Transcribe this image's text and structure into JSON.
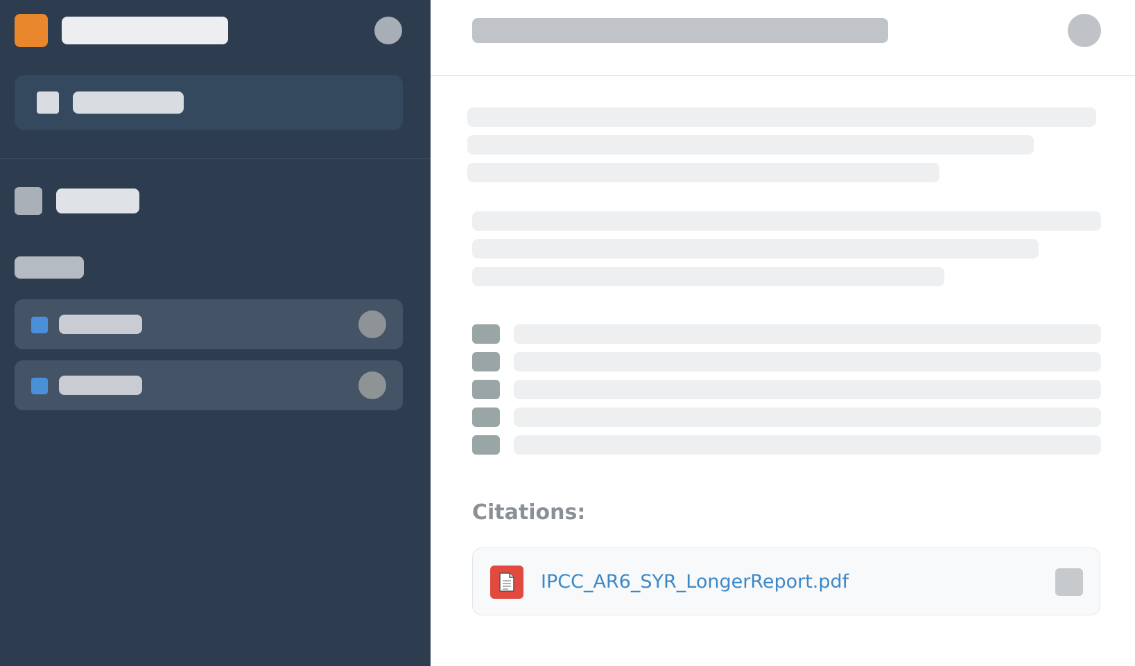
{
  "brand": {
    "logo_color": "#e8872c"
  },
  "sidebar": {
    "new_chat": {
      "icon": "plus-icon"
    },
    "nav": {
      "icon": "folder-icon"
    },
    "items": [
      {
        "icon": "chat-icon",
        "accent": "#4a90d9"
      },
      {
        "icon": "chat-icon",
        "accent": "#4a90d9"
      }
    ]
  },
  "main": {
    "citations": {
      "heading": "Citations:",
      "items": [
        {
          "file_name": "IPCC_AR6_SYR_LongerReport.pdf",
          "icon": "pdf-file-icon",
          "icon_color": "#e24a3f",
          "link_color": "#3d88c7"
        }
      ]
    }
  }
}
